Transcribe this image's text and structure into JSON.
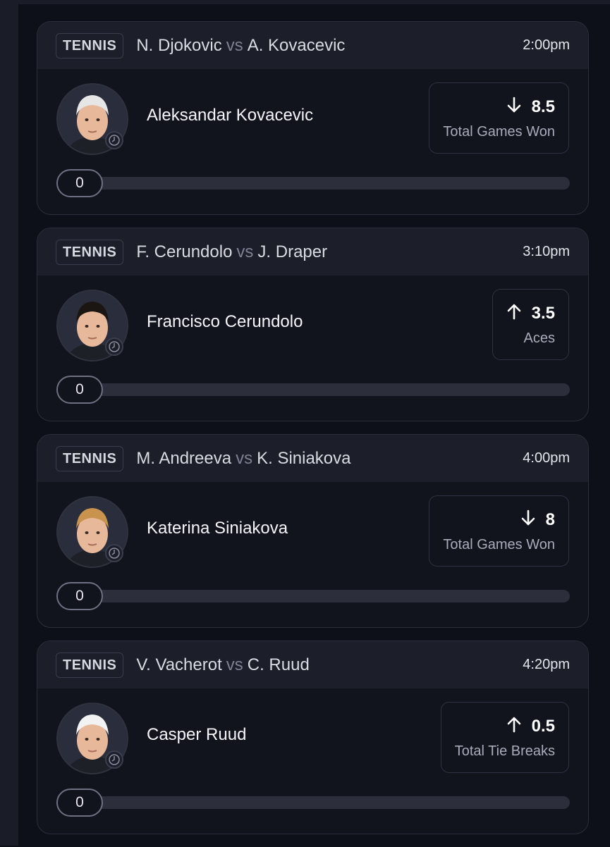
{
  "cards": [
    {
      "sport": "TENNIS",
      "player_a": "N. Djokovic",
      "vs": "vs",
      "player_b": "A. Kovacevic",
      "time": "2:00pm",
      "pick_player": "Aleksandar Kovacevic",
      "direction": "down",
      "line": "8.5",
      "stat": "Total Games Won",
      "progress_value": "0",
      "avatar_icon": "player-avatar-icon",
      "hair_color": "#e6e6e6"
    },
    {
      "sport": "TENNIS",
      "player_a": "F. Cerundolo",
      "vs": "vs",
      "player_b": "J. Draper",
      "time": "3:10pm",
      "pick_player": "Francisco Cerundolo",
      "direction": "up",
      "line": "3.5",
      "stat": "Aces",
      "progress_value": "0",
      "avatar_icon": "player-avatar-icon",
      "hair_color": "#1c1612"
    },
    {
      "sport": "TENNIS",
      "player_a": "M. Andreeva",
      "vs": "vs",
      "player_b": "K. Siniakova",
      "time": "4:00pm",
      "pick_player": "Katerina Siniakova",
      "direction": "down",
      "line": "8",
      "stat": "Total Games Won",
      "progress_value": "0",
      "avatar_icon": "player-avatar-icon",
      "hair_color": "#c9924d"
    },
    {
      "sport": "TENNIS",
      "player_a": "V. Vacherot",
      "vs": "vs",
      "player_b": "C. Ruud",
      "time": "4:20pm",
      "pick_player": "Casper Ruud",
      "direction": "up",
      "line": "0.5",
      "stat": "Total Tie Breaks",
      "progress_value": "0",
      "avatar_icon": "player-avatar-icon",
      "hair_color": "#f2f2f2"
    }
  ],
  "colors": {
    "background": "#0e1019",
    "card": "#11131d",
    "header": "#1c1e29",
    "muted_text": "#a9acba"
  }
}
